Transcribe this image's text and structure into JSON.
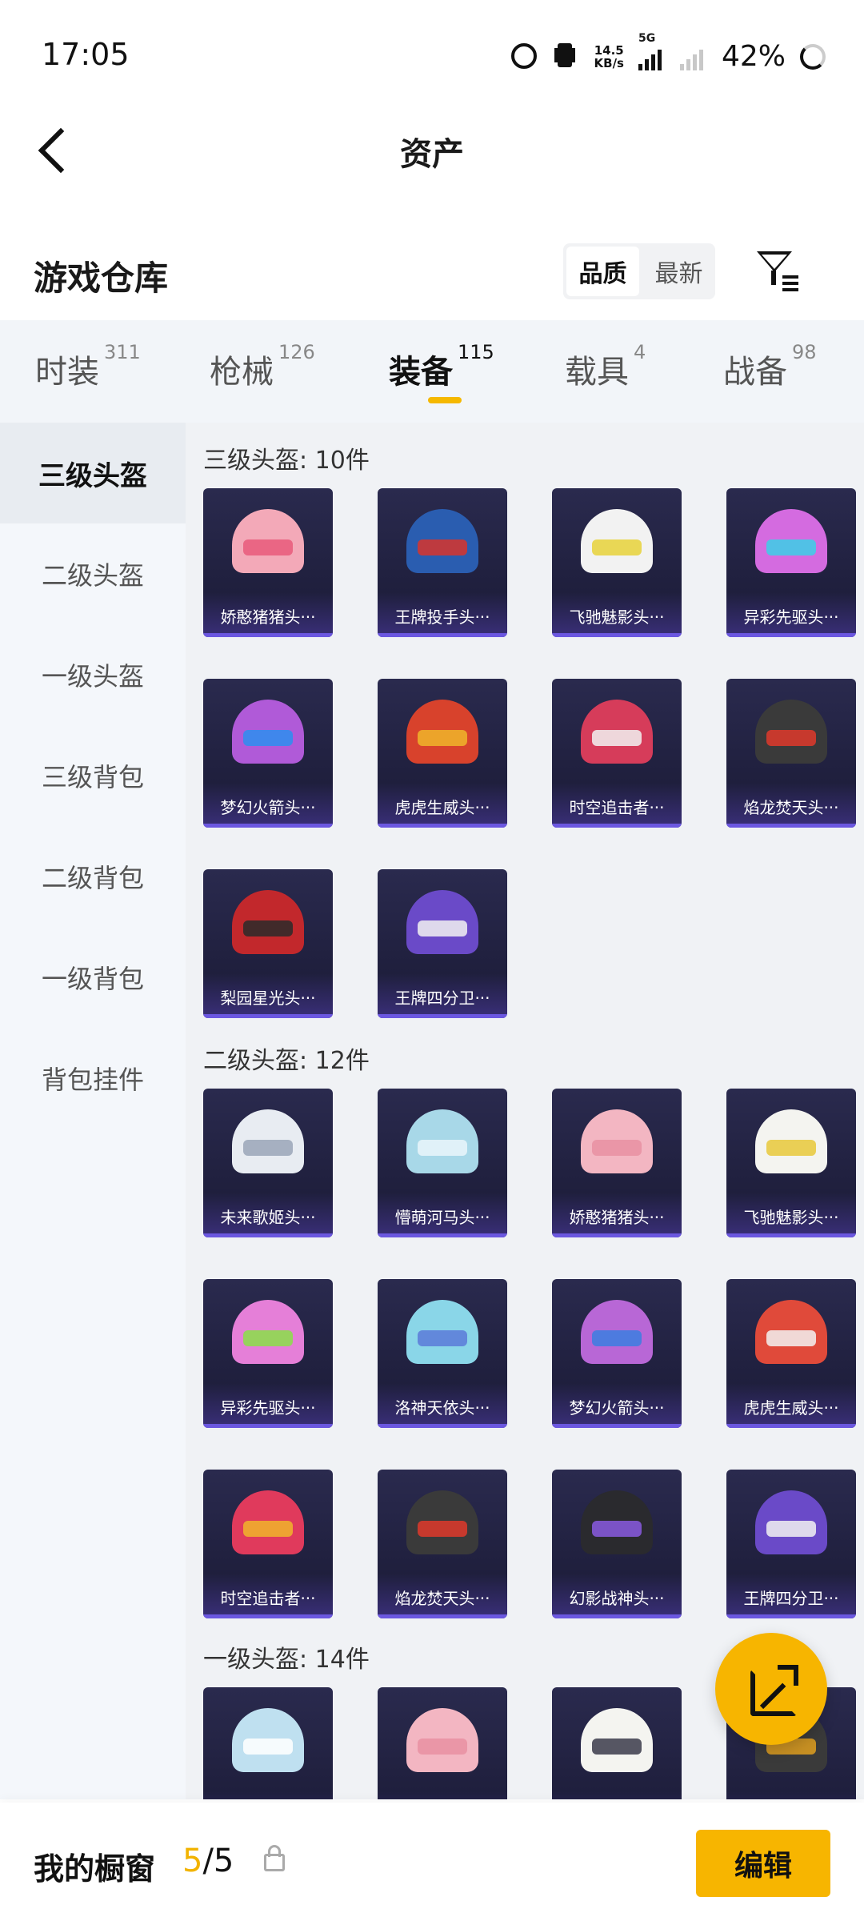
{
  "status_bar": {
    "time": "17:05",
    "net_speed_top": "14.5",
    "net_speed_bottom": "KB/s",
    "network": "5G",
    "battery": "42%"
  },
  "nav": {
    "title": "资产"
  },
  "warehouse": {
    "title": "游戏仓库",
    "sort_options": [
      "品质",
      "最新"
    ],
    "sort_selected": "品质"
  },
  "tabs": [
    {
      "label": "时装",
      "count": "311"
    },
    {
      "label": "枪械",
      "count": "126"
    },
    {
      "label": "装备",
      "count": "115",
      "active": true
    },
    {
      "label": "载具",
      "count": "4"
    },
    {
      "label": "战备",
      "count": "98"
    }
  ],
  "sidebar": {
    "items": [
      {
        "label": "三级头盔",
        "active": true
      },
      {
        "label": "二级头盔"
      },
      {
        "label": "一级头盔"
      },
      {
        "label": "三级背包"
      },
      {
        "label": "二级背包"
      },
      {
        "label": "一级背包"
      },
      {
        "label": "背包挂件"
      }
    ]
  },
  "sections": [
    {
      "title": "三级头盔: 10件",
      "items": [
        {
          "name": "娇憨猪猪头···",
          "color": "#f3a9b8",
          "visor": "#e85a7a"
        },
        {
          "name": "王牌投手头···",
          "color": "#2a5db0",
          "visor": "#d8342c"
        },
        {
          "name": "飞驰魅影头···",
          "color": "#f2f2f2",
          "visor": "#e8d23a"
        },
        {
          "name": "异彩先驱头···",
          "color": "#d46be0",
          "visor": "#3ad0e6"
        },
        {
          "name": "梦幻火箭头···",
          "color": "#b05ad8",
          "visor": "#2c8ff0"
        },
        {
          "name": "虎虎生威头···",
          "color": "#d8422c",
          "visor": "#f0b52a"
        },
        {
          "name": "时空追击者···",
          "color": "#d63c5a",
          "visor": "#f2f2f2"
        },
        {
          "name": "焰龙焚天头···",
          "color": "#3a3a3a",
          "visor": "#e03a2c"
        },
        {
          "name": "梨园星光头···",
          "color": "#c2282c",
          "visor": "#2a2a2a"
        },
        {
          "name": "王牌四分卫···",
          "color": "#6a4ac8",
          "visor": "#f2f2f2"
        }
      ]
    },
    {
      "title": "二级头盔: 12件",
      "items": [
        {
          "name": "未来歌姬头···",
          "color": "#e8ecf2",
          "visor": "#9aa6b8"
        },
        {
          "name": "懵萌河马头···",
          "color": "#a8d8e8",
          "visor": "#eaf6fa"
        },
        {
          "name": "娇憨猪猪头···",
          "color": "#f3b6c2",
          "visor": "#e890a2"
        },
        {
          "name": "飞驰魅影头···",
          "color": "#f4f4f0",
          "visor": "#e8c83a"
        },
        {
          "name": "异彩先驱头···",
          "color": "#e57fd8",
          "visor": "#8ae048"
        },
        {
          "name": "洛神天依头···",
          "color": "#8ad6e8",
          "visor": "#5a7ad8"
        },
        {
          "name": "梦幻火箭头···",
          "color": "#b867d6",
          "visor": "#3a7fe0"
        },
        {
          "name": "虎虎生威头···",
          "color": "#e04a3a",
          "visor": "#f2f2f2"
        },
        {
          "name": "时空追击者···",
          "color": "#e03a5c",
          "visor": "#f0b52a"
        },
        {
          "name": "焰龙焚天头···",
          "color": "#3a3a3a",
          "visor": "#e03a2c"
        },
        {
          "name": "幻影战神头···",
          "color": "#2a2a2e",
          "visor": "#8a5ae0"
        },
        {
          "name": "王牌四分卫···",
          "color": "#6a4ac8",
          "visor": "#f2f2f2"
        }
      ]
    },
    {
      "title": "一级头盔: 14件",
      "items": [
        {
          "name": "",
          "color": "#bfe0f0",
          "visor": "#ffffff"
        },
        {
          "name": "",
          "color": "#f3b6c2",
          "visor": "#e890a2"
        },
        {
          "name": "",
          "color": "#f4f4f0",
          "visor": "#3a3a4a"
        },
        {
          "name": "",
          "color": "#3a3a3a",
          "visor": "#e0a020"
        }
      ]
    }
  ],
  "bottom_bar": {
    "label": "我的橱窗",
    "current": "5",
    "total": "/5",
    "edit_label": "编辑"
  },
  "colors": {
    "accent": "#f7b500",
    "card_bg": "#1f1f3d",
    "card_border": "#6b57e0"
  }
}
